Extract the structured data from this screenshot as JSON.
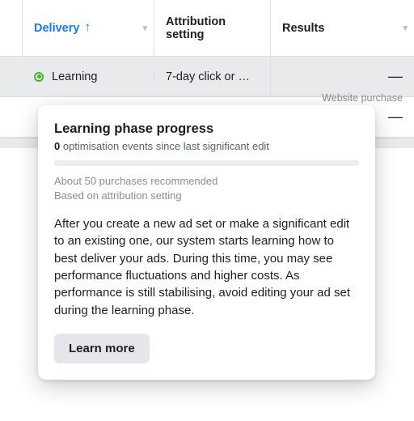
{
  "headers": {
    "delivery": "Delivery",
    "attribution": "Attribution setting",
    "results": "Results"
  },
  "rows": [
    {
      "delivery_status": "Learning",
      "attribution": "7-day click or …",
      "results_value": "—",
      "results_sub": "Website purchase"
    },
    {
      "delivery_status": "",
      "attribution": "",
      "results_value": "—",
      "results_sub": ""
    }
  ],
  "tooltip": {
    "title": "Learning phase progress",
    "events_count": "0",
    "events_text": " optimisation events since last significant edit",
    "hint_line1": "About 50 purchases recommended",
    "hint_line2": "Based on attribution setting",
    "body": "After you create a new ad set or make a significant edit to an existing one, our system starts learning how to best deliver your ads. During this time, you may see performance fluctuations and higher costs. As performance is still stabilising, avoid editing your ad set during the learning phase.",
    "learn_more": "Learn more"
  }
}
